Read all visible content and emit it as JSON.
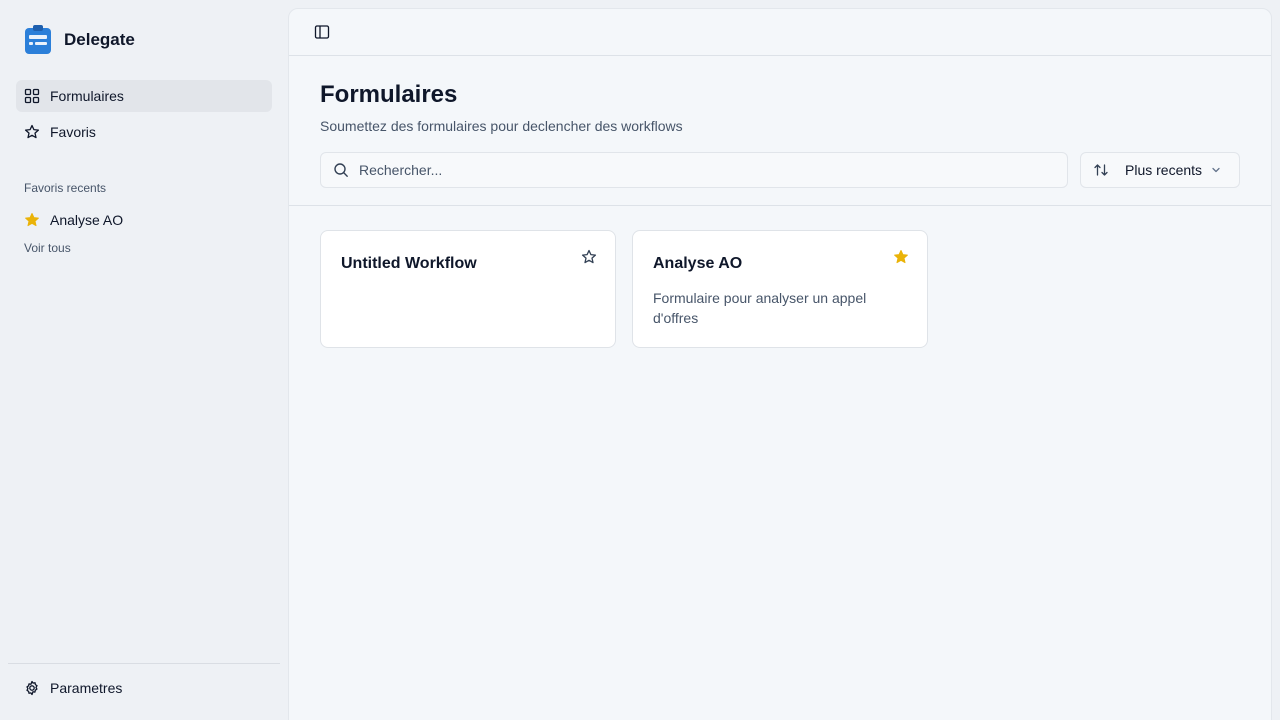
{
  "app": {
    "name": "Delegate"
  },
  "sidebar": {
    "nav": [
      {
        "label": "Formulaires",
        "icon": "grid-icon",
        "active": true
      },
      {
        "label": "Favoris",
        "icon": "star-outline-icon",
        "active": false
      }
    ],
    "recent_section_label": "Favoris recents",
    "recent_items": [
      {
        "label": "Analyse AO",
        "icon": "star-filled-icon"
      }
    ],
    "see_all_label": "Voir tous",
    "settings_label": "Parametres"
  },
  "main": {
    "title": "Formulaires",
    "subtitle": "Soumettez des formulaires pour declencher des workflows",
    "search": {
      "placeholder": "Rechercher...",
      "value": ""
    },
    "sort": {
      "label": "Plus recents"
    },
    "cards": [
      {
        "title": "Untitled Workflow",
        "description": "",
        "favorite": false
      },
      {
        "title": "Analyse AO",
        "description": "Formulaire pour analyser un appel d'offres",
        "favorite": true
      }
    ]
  },
  "colors": {
    "accent": "#2b7fd9",
    "star_filled": "#eab308",
    "sidebar_bg": "#eef1f5",
    "main_bg": "#f4f7fa"
  }
}
